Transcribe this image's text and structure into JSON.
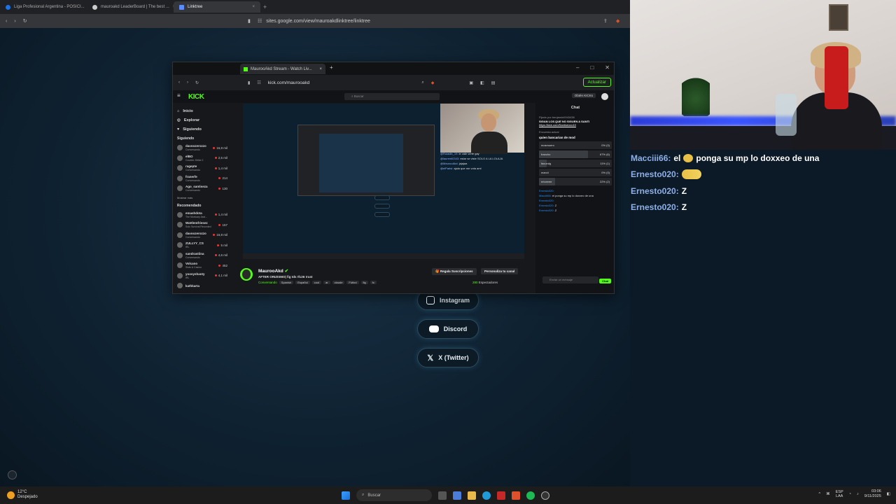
{
  "outer_browser": {
    "tabs": [
      {
        "title": "Liga Profesional Argentina - POSICI...",
        "color": "#1a73e8"
      },
      {
        "title": "mauroakd LeaderBoard | The best ...",
        "color": "#d0d0d0"
      },
      {
        "title": "Linktree",
        "color": "#5b8cff",
        "active": true
      }
    ],
    "url": "sites.google.com/view/mauroakdlinktree/linktree"
  },
  "linktree": {
    "buttons": [
      {
        "label": "Instagram",
        "icon": "instagram-icon"
      },
      {
        "label": "Discord",
        "icon": "discord-icon"
      },
      {
        "label": "X (Twitter)",
        "icon": "x-icon"
      }
    ]
  },
  "inner_browser": {
    "tab_title": "MaurooAkd Stream - Watch Liv...",
    "url": "kick.com/maurooakd",
    "update_label": "Actualizar"
  },
  "kick": {
    "logo": "KICK",
    "search_placeholder": "Buscar",
    "obtain_label": "Obtén KICKs",
    "nav": [
      "Inicio",
      "Explorar",
      "Siguiendo"
    ],
    "following_title": "Siguiendo",
    "following": [
      {
        "name": "davoozerozzo",
        "sub": "Conversando",
        "count": "16,8 mil"
      },
      {
        "name": "elBO",
        "sub": "Counter-Strike 2",
        "count": "2,5 mil"
      },
      {
        "name": "ragepte",
        "sub": "Conversando",
        "count": "1,4 mil"
      },
      {
        "name": "franerfe",
        "sub": "Conversando",
        "count": "214"
      },
      {
        "name": "Ago_santiseza",
        "sub": "Conversando",
        "count": "130"
      }
    ],
    "show_more": "Mostrar más",
    "recommended_title": "Recomendado",
    "recommended": [
      {
        "name": "emashdota",
        "sub": "The Mortuary Assi...",
        "count": "1,4 mil"
      },
      {
        "name": "Wattlemfriesez",
        "sub": "Solo Survival Recorded",
        "count": "157"
      },
      {
        "name": "davoozerozzo",
        "sub": "Conversando",
        "count": "16,8 mil"
      },
      {
        "name": "ZULLYY_CS",
        "sub": "IRL",
        "count": "5 mil"
      },
      {
        "name": "sandrastiina",
        "sub": "Conversando",
        "count": "4,6 mil"
      },
      {
        "name": "Volcano",
        "sub": "Slots & Casino",
        "count": "452"
      },
      {
        "name": "yoosyshanty",
        "sub": "IRL",
        "count": "4,1 mil"
      },
      {
        "name": "kathkarta",
        "sub": "",
        "count": ""
      }
    ],
    "streamer": "MaurooAkd",
    "stream_title": "AFTER ORIZISMO| fig tds !fc26 !rust",
    "category": "Conversando",
    "tags": [
      "Spanish",
      "Español",
      "cool",
      "ar",
      "claude",
      "Fútbol",
      "fig",
      "fc"
    ],
    "subs_button": "Regala Suscripciones",
    "customize_button": "Personaliza tu canal",
    "viewers": "280",
    "viewers_label": "Espectadores",
    "preview_chat": [
      {
        "user": "@Ruiadib_19:",
        "text": "le vale verte gay"
      },
      {
        "user": "@laurenti0343:",
        "text": "estar se viste SOLO A LA LOLAJA"
      },
      {
        "user": "@MaurooAkd:",
        "text": "jajajaa"
      },
      {
        "user": "@elParisi:",
        "text": "ajala que me vota ami"
      }
    ]
  },
  "kick_chat": {
    "title": "Chat",
    "pinned_by": "Fijado por benjamin0943438",
    "pinned_text": "SIGAN LOS QUE NO SIGUEN A SANTI",
    "pinned_link": "https://kick.com/Santiorizzo10",
    "poll_label": "Encuesta actual",
    "poll_question": "quien bancarian de mod",
    "poll_options": [
      {
        "label": "mosmuero",
        "pct": "0% (0)",
        "fraction": 0.0
      },
      {
        "label": "francho",
        "pct": "67% (6)",
        "fraction": 0.67
      },
      {
        "label": "facundg",
        "pct": "11% (1)",
        "fraction": 0.11
      },
      {
        "label": "marcii",
        "pct": "0% (0)",
        "fraction": 0.0
      },
      {
        "label": "ericeeee",
        "pct": "22% (2)",
        "fraction": 0.22
      }
    ],
    "messages": [
      {
        "user": "Ernesto020:",
        "text": ""
      },
      {
        "user": "Macciii66:",
        "text": "el ponga su mp lo doxxeo de una"
      },
      {
        "user": "Ernesto020:",
        "text": ""
      },
      {
        "user": "Ernesto020:",
        "text": "Z"
      },
      {
        "user": "Ernesto020:",
        "text": "Z"
      }
    ],
    "input_placeholder": "Enviar un mensaje",
    "send_label": "Chat"
  },
  "overlay_chat": [
    {
      "user": "Macciii66:",
      "text": "el",
      "emote": "coin",
      "after": "ponga su mp lo doxxeo de una"
    },
    {
      "user": "Ernesto020:",
      "text": "",
      "emote": "lol",
      "after": ""
    },
    {
      "user": "Ernesto020:",
      "text": "Z",
      "emote": "",
      "after": ""
    },
    {
      "user": "Ernesto020:",
      "text": "Z",
      "emote": "",
      "after": ""
    }
  ],
  "taskbar": {
    "temp": "12°C",
    "weather": "Despejado",
    "search": "Buscar",
    "lang": "ESP",
    "lang2": "LAA",
    "time": "03:06",
    "date": "9/11/2025"
  }
}
